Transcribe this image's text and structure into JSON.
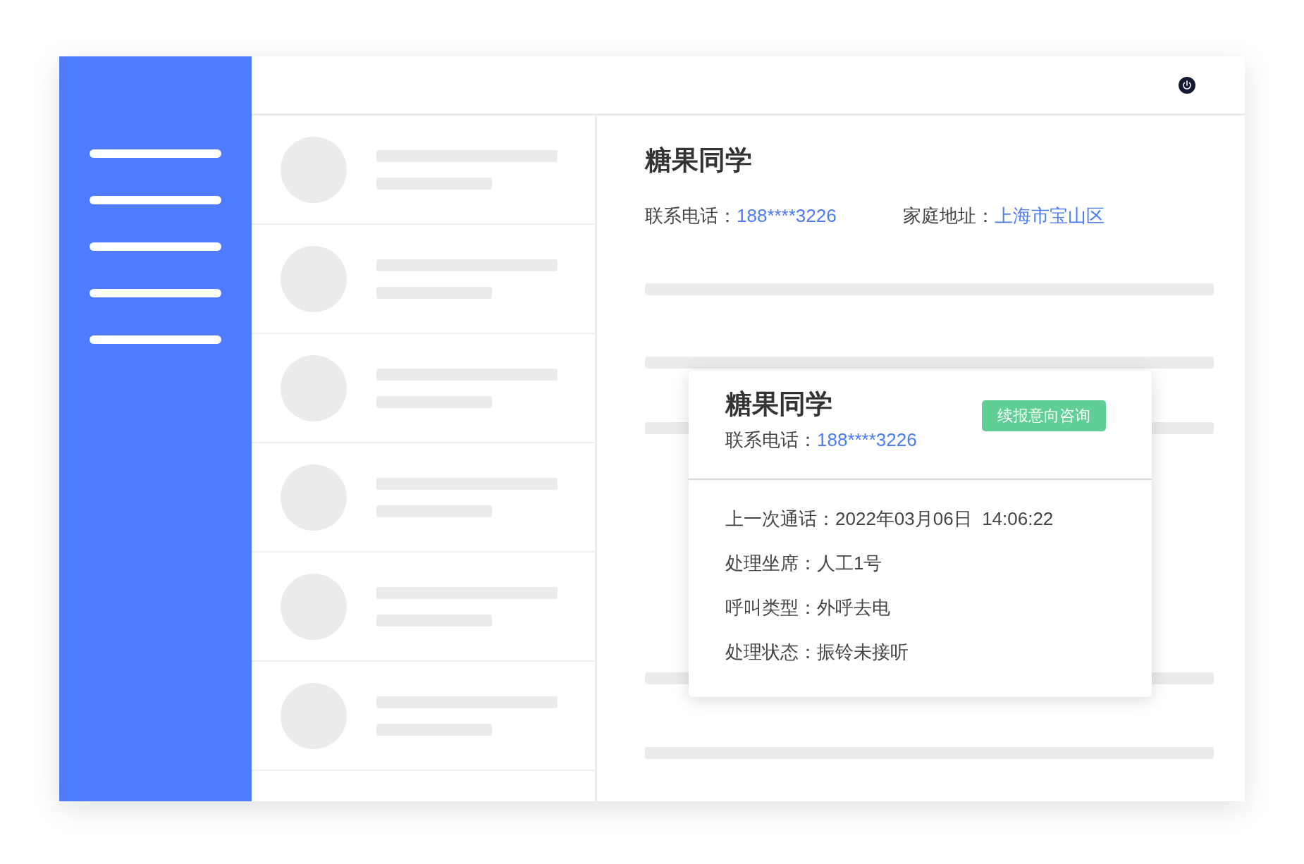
{
  "detail": {
    "name": "糖果同学",
    "fields": [
      {
        "label": "联系电话：",
        "value": "188****3226"
      },
      {
        "label": "家庭地址：",
        "value": "上海市宝山区"
      }
    ]
  },
  "popup": {
    "name": "糖果同学",
    "tag": "续报意向咨询",
    "phone": {
      "label": "联系电话：",
      "value": "188****3226"
    },
    "records": [
      {
        "label": "上一次通话：",
        "value": "2022年03月06日  14:06:22"
      },
      {
        "label": "处理坐席：",
        "value": "人工1号"
      },
      {
        "label": "呼叫类型：",
        "value": "外呼去电"
      },
      {
        "label": "处理状态：",
        "value": "振铃未接听"
      }
    ]
  }
}
